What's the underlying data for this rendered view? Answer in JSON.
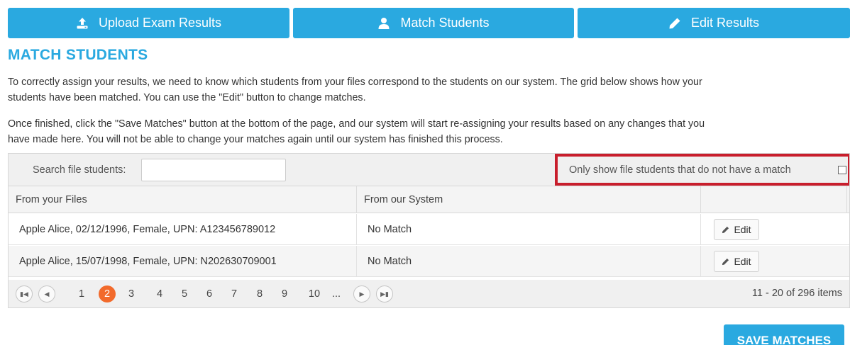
{
  "colors": {
    "accent": "#2aa9e0",
    "active_page": "#f26a2b",
    "highlight_border": "#c81e2c"
  },
  "tabs": [
    {
      "label": "Upload Exam Results",
      "icon": "upload-icon"
    },
    {
      "label": "Match Students",
      "icon": "user-icon"
    },
    {
      "label": "Edit Results",
      "icon": "pencil-icon"
    }
  ],
  "page_title": "MATCH STUDENTS",
  "intro": {
    "line1": "To correctly assign your results, we need to know which students from your files correspond to the students on our system. The grid below shows how your",
    "line2": "students have been matched. You can use the \"Edit\" button to change matches."
  },
  "instructions": {
    "line1": "Once finished, click the \"Save Matches\" button at the bottom of the page, and our system will start re-assigning your results based on any changes that you",
    "line2": "have made here. You will not be able to change your matches again until our system has finished this process."
  },
  "toolbar": {
    "search_label": "Search file students:",
    "search_value": "",
    "filter_label": "Only show file students that do not have a match",
    "filter_checked": false
  },
  "table": {
    "columns": [
      "From your Files",
      "From our System",
      ""
    ],
    "rows": [
      {
        "file_student": "Apple Alice, 02/12/1996, Female, UPN: A123456789012",
        "system_student": "No Match",
        "action": "Edit"
      },
      {
        "file_student": "Apple Alice, 15/07/1998, Female, UPN: N202630709001",
        "system_student": "No Match",
        "action": "Edit"
      }
    ]
  },
  "pager": {
    "pages": [
      "1",
      "2",
      "3",
      "4",
      "5",
      "6",
      "7",
      "8",
      "9",
      "10",
      "..."
    ],
    "current_page": "2",
    "info": "11 - 20 of 296 items",
    "nav_icons": [
      "first-page-icon",
      "prev-page-icon",
      "next-page-icon",
      "last-page-icon"
    ]
  },
  "save_button": "SAVE MATCHES"
}
